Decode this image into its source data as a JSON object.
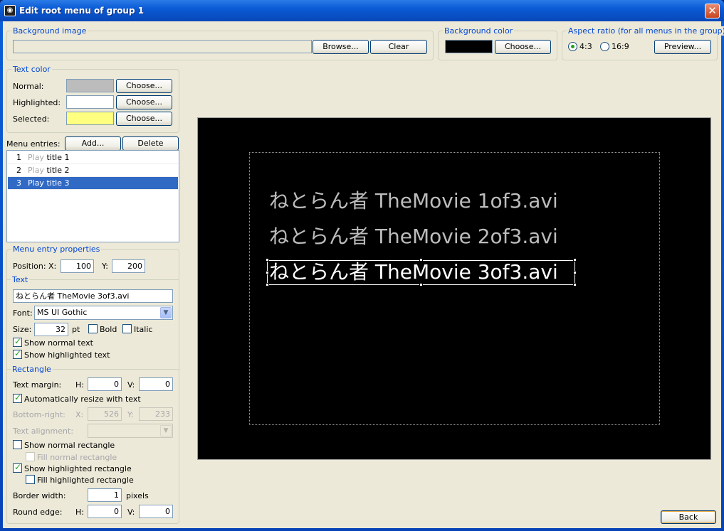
{
  "window": {
    "title": "Edit root menu of group 1",
    "close": "✕"
  },
  "background_image": {
    "label": "Background image",
    "value": "",
    "browse": "Browse...",
    "clear": "Clear"
  },
  "background_color": {
    "label": "Background color",
    "color": "#000000",
    "choose": "Choose..."
  },
  "aspect": {
    "label": "Aspect ratio (for all menus in the group)",
    "opt1": "4:3",
    "opt2": "16:9",
    "selected": "4:3",
    "preview": "Preview..."
  },
  "text_color": {
    "label": "Text color",
    "normal": "Normal:",
    "normal_color": "#bcbcbc",
    "highlighted": "Highlighted:",
    "highlighted_color": "#ffffff",
    "selected": "Selected:",
    "selected_color": "#ffff80",
    "choose": "Choose..."
  },
  "menu_entries": {
    "label": "Menu entries:",
    "add": "Add...",
    "delete": "Delete",
    "items": [
      {
        "num": "1",
        "prefix": "Play",
        "title": "title 1"
      },
      {
        "num": "2",
        "prefix": "Play",
        "title": "title 2"
      },
      {
        "num": "3",
        "prefix": "Play",
        "title": "title 3"
      }
    ],
    "selected_index": 2
  },
  "props": {
    "label": "Menu entry properties",
    "position": "Position:",
    "x_label": "X:",
    "x": "100",
    "y_label": "Y:",
    "y": "200",
    "text_group": "Text",
    "text_value": "ねとらん者 TheMovie 3of3.avi",
    "font_label": "Font:",
    "font": "MS UI Gothic",
    "size_label": "Size:",
    "size": "32",
    "pt": "pt",
    "bold": "Bold",
    "italic": "Italic",
    "show_normal": "Show normal text",
    "show_highlighted": "Show highlighted text"
  },
  "rect": {
    "label": "Rectangle",
    "margin": "Text margin:",
    "h_label": "H:",
    "h": "0",
    "v_label": "V:",
    "v": "0",
    "auto_resize": "Automatically resize with text",
    "bottom_right": "Bottom-right:",
    "br_x_label": "X:",
    "br_x": "526",
    "br_y_label": "Y:",
    "br_y": "233",
    "alignment": "Text alignment:",
    "show_normal_rect": "Show normal rectangle",
    "fill_normal_rect": "Fill normal rectangle",
    "show_hl_rect": "Show highlighted rectangle",
    "fill_hl_rect": "Fill highlighted rectangle",
    "border": "Border width:",
    "border_value": "1",
    "pixels": "pixels",
    "round": "Round edge:",
    "round_h_label": "H:",
    "round_h": "0",
    "round_v_label": "V:",
    "round_v": "0"
  },
  "preview": {
    "entries": [
      "ねとらん者 TheMovie 1of3.avi",
      "ねとらん者 TheMovie 2of3.avi",
      "ねとらん者 TheMovie 3of3.avi"
    ]
  },
  "footer": {
    "back": "Back"
  }
}
